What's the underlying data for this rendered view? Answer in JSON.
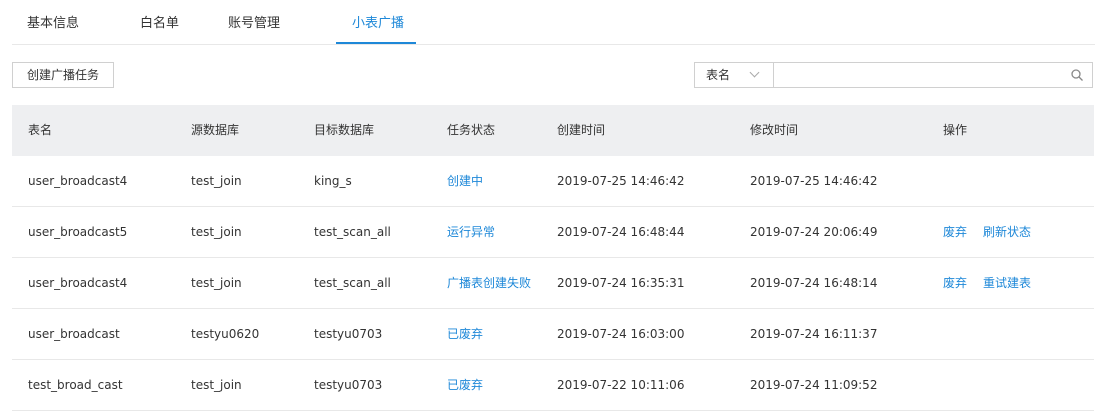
{
  "tabs": [
    {
      "label": "基本信息"
    },
    {
      "label": "白名单"
    },
    {
      "label": "账号管理"
    },
    {
      "label": "小表广播"
    }
  ],
  "toolbar": {
    "create_label": "创建广播任务"
  },
  "search": {
    "field_label": "表名",
    "value": ""
  },
  "table": {
    "columns": [
      "表名",
      "源数据库",
      "目标数据库",
      "任务状态",
      "创建时间",
      "修改时间",
      "操作"
    ],
    "rows": [
      {
        "table": "user_broadcast4",
        "source": "test_join",
        "target": "king_s",
        "status": "创建中",
        "created": "2019-07-25 14:46:42",
        "modified": "2019-07-25 14:46:42",
        "actions": []
      },
      {
        "table": "user_broadcast5",
        "source": "test_join",
        "target": "test_scan_all",
        "status": "运行异常",
        "created": "2019-07-24 16:48:44",
        "modified": "2019-07-24 20:06:49",
        "actions": [
          "废弃",
          "刷新状态"
        ]
      },
      {
        "table": "user_broadcast4",
        "source": "test_join",
        "target": "test_scan_all",
        "status": "广播表创建失败",
        "created": "2019-07-24 16:35:31",
        "modified": "2019-07-24 16:48:14",
        "actions": [
          "废弃",
          "重试建表"
        ]
      },
      {
        "table": "user_broadcast",
        "source": "testyu0620",
        "target": "testyu0703",
        "status": "已废弃",
        "created": "2019-07-24 16:03:00",
        "modified": "2019-07-24 16:11:37",
        "actions": []
      },
      {
        "table": "test_broad_cast",
        "source": "test_join",
        "target": "testyu0703",
        "status": "已废弃",
        "created": "2019-07-22 10:11:06",
        "modified": "2019-07-24 11:09:52",
        "actions": []
      }
    ]
  },
  "colors": {
    "accent": "#1e88d8",
    "header_bg": "#eeeff1",
    "border": "#e8e8e8"
  }
}
